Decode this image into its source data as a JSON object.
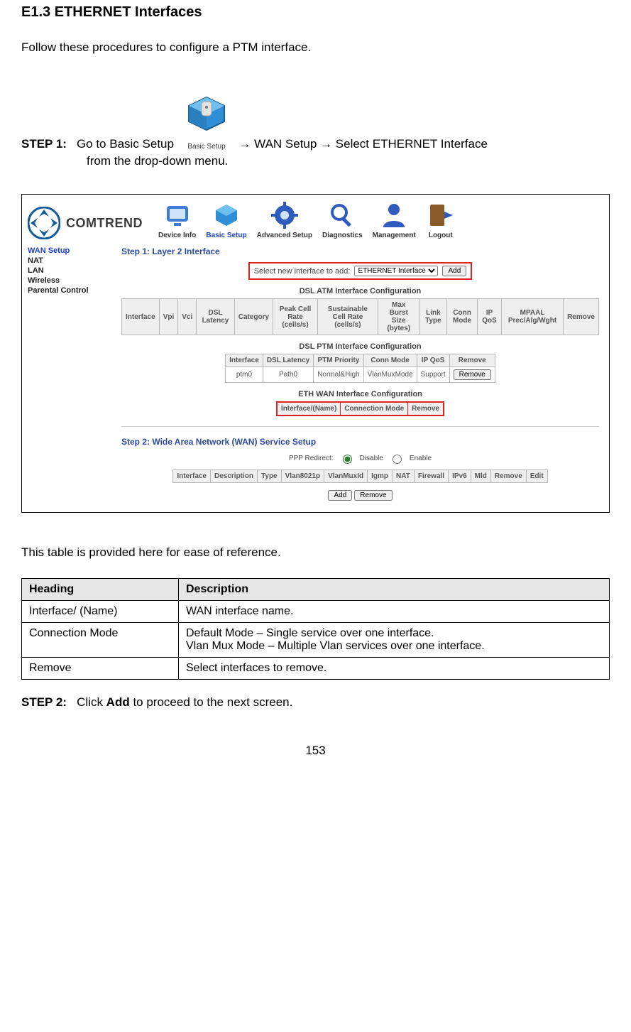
{
  "title": "E1.3 ETHERNET Interfaces",
  "intro": "Follow these procedures to configure a PTM interface.",
  "step1": {
    "label": "STEP 1:",
    "pre": "Go to Basic Setup",
    "post": " → WAN Setup → Select ETHERNET Interface",
    "cont": "from the drop-down menu.",
    "icon_caption": "Basic Setup"
  },
  "shot": {
    "brand": "COMTREND",
    "nav": {
      "device_info": "Device Info",
      "basic_setup": "Basic Setup",
      "advanced": "Advanced Setup",
      "diagnostics": "Diagnostics",
      "management": "Management",
      "logout": "Logout"
    },
    "side": {
      "wan": "WAN Setup",
      "nat": "NAT",
      "lan": "LAN",
      "wireless": "Wireless",
      "parental": "Parental Control"
    },
    "layer2_title": "Step 1: Layer 2 Interface",
    "select_label": "Select new interface to add:",
    "select_value": "ETHERNET Interface",
    "add_btn": "Add",
    "atm": {
      "title": "DSL ATM Interface Configuration",
      "headers": [
        "Interface",
        "Vpi",
        "Vci",
        "DSL Latency",
        "Category",
        "Peak Cell Rate (cells/s)",
        "Sustainable Cell Rate (cells/s)",
        "Max Burst Size (bytes)",
        "Link Type",
        "Conn Mode",
        "IP QoS",
        "MPAAL Prec/Alg/Wght",
        "Remove"
      ]
    },
    "ptm": {
      "title": "DSL PTM Interface Configuration",
      "headers": [
        "Interface",
        "DSL Latency",
        "PTM Priority",
        "Conn Mode",
        "IP QoS",
        "Remove"
      ],
      "row": [
        "ptm0",
        "Path0",
        "Normal&High",
        "VlanMuxMode",
        "Support"
      ],
      "remove_btn": "Remove"
    },
    "eth": {
      "title": "ETH WAN Interface Configuration",
      "headers": [
        "Interface/(Name)",
        "Connection Mode",
        "Remove"
      ]
    },
    "wan_title": "Step 2: Wide Area Network (WAN) Service Setup",
    "ppp": {
      "label": "PPP Redirect:",
      "disable": "Disable",
      "enable": "Enable"
    },
    "wan_headers": [
      "Interface",
      "Description",
      "Type",
      "Vlan8021p",
      "VlanMuxId",
      "Igmp",
      "NAT",
      "Firewall",
      "IPv6",
      "Mld",
      "Remove",
      "Edit"
    ],
    "btns": {
      "add": "Add",
      "remove": "Remove"
    }
  },
  "ref_intro": "This table is provided here for ease of reference.",
  "ref": {
    "head": {
      "heading": "Heading",
      "description": "Description"
    },
    "rows": [
      {
        "h": "Interface/ (Name)",
        "d": "WAN interface name."
      },
      {
        "h": "Connection Mode",
        "d": "Default Mode – Single service over one interface.\nVlan Mux Mode – Multiple Vlan services over one interface."
      },
      {
        "h": "Remove",
        "d": "Select interfaces to remove."
      }
    ]
  },
  "step2": {
    "label": "STEP 2:",
    "pre": "Click ",
    "bold": "Add",
    "post": " to proceed to the next screen."
  },
  "page_number": "153"
}
